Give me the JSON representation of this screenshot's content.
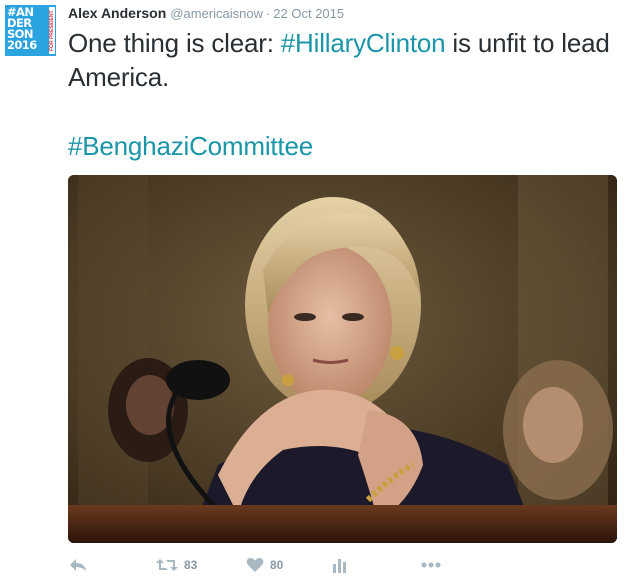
{
  "tweet": {
    "avatar": {
      "text": "#AN\nDER\nSON\n2016",
      "side_text": "FOR PRESIDENT",
      "bg_color": "#2aa3df"
    },
    "author_name": "Alex Anderson",
    "handle": "@americaisnow",
    "separator": "·",
    "date": "22 Oct 2015",
    "text_part1": "One thing is clear: ",
    "hashtag1": "#HillaryClinton",
    "text_part2": " is unfit to lead America.",
    "hashtag2": "#BenghaziCommittee",
    "photo_icon": "photo-of-woman-at-hearing",
    "actions": {
      "reply_icon": "reply-icon",
      "retweet_icon": "retweet-icon",
      "retweet_count": "83",
      "like_icon": "heart-icon",
      "like_count": "80",
      "stats_icon": "bar-chart-icon",
      "more_icon": "more-dots-icon"
    }
  },
  "colors": {
    "hashtag": "#1b95a8",
    "muted": "#8899a6",
    "icon": "#aab8c2",
    "text": "#292f33"
  }
}
